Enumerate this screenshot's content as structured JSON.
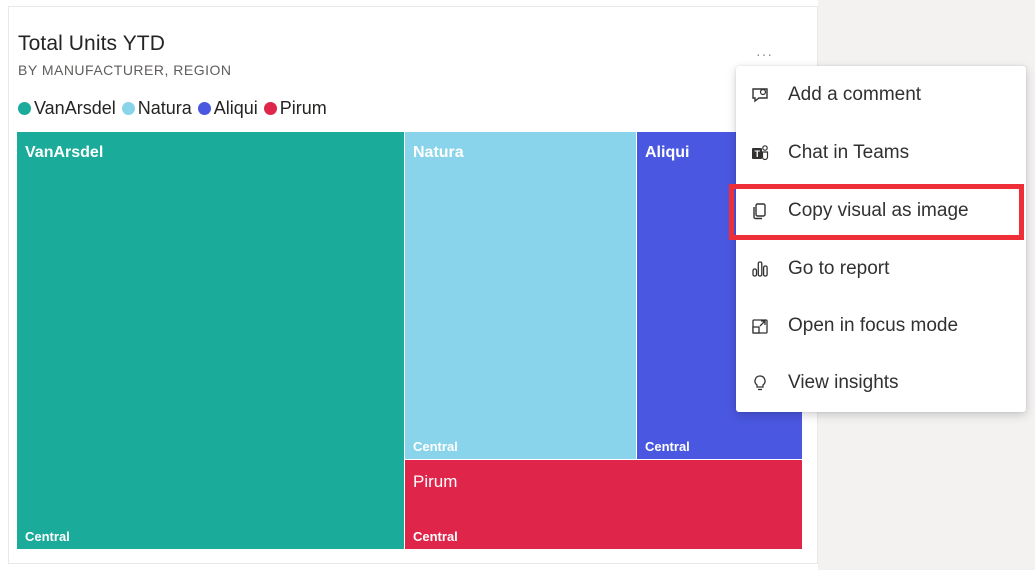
{
  "visual": {
    "title": "Total Units YTD",
    "subtitle": "BY MANUFACTURER, REGION",
    "more_options": "···"
  },
  "legend": [
    {
      "label": "VanArsdel",
      "color": "#1aab9b"
    },
    {
      "label": "Natura",
      "color": "#8ad4eb"
    },
    {
      "label": "Aliqui",
      "color": "#4a57e0"
    },
    {
      "label": "Pirum",
      "color": "#e0254a"
    }
  ],
  "chart_data": {
    "type": "treemap",
    "tiles": [
      {
        "name": "VanArsdel",
        "region": "Central",
        "color": "#1aab9b"
      },
      {
        "name": "Natura",
        "region": "Central",
        "color": "#8ad4eb"
      },
      {
        "name": "Aliqui",
        "region": "Central",
        "color": "#4a57e0"
      },
      {
        "name": "Pirum",
        "region": "Central",
        "color": "#e0254a"
      }
    ]
  },
  "menu": {
    "items": [
      {
        "label": "Add a comment",
        "icon": "comment-icon"
      },
      {
        "label": "Chat in Teams",
        "icon": "teams-icon"
      },
      {
        "label": "Copy visual as image",
        "icon": "copy-icon",
        "highlighted": true
      },
      {
        "label": "Go to report",
        "icon": "report-icon"
      },
      {
        "label": "Open in focus mode",
        "icon": "focus-mode-icon"
      },
      {
        "label": "View insights",
        "icon": "lightbulb-icon"
      }
    ]
  },
  "colors": {
    "highlight": "#ee2f37",
    "text": "#323130",
    "background_right": "#f3f2f1"
  }
}
